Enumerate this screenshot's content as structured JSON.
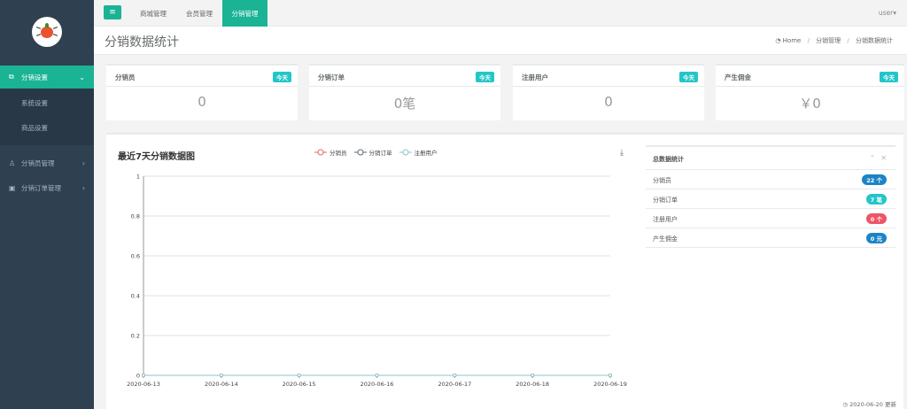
{
  "sidebar": {
    "items": [
      {
        "label": "分销设置",
        "icon": "sitemap-icon",
        "arrow": "⌄",
        "active": true
      },
      {
        "label": "分销员管理",
        "icon": "user-icon",
        "arrow": "›"
      },
      {
        "label": "分销订单管理",
        "icon": "order-icon",
        "arrow": "›"
      }
    ],
    "sub_items": [
      "系统设置",
      "商品设置"
    ]
  },
  "topbar": {
    "menu_icon": "bars-icon",
    "tabs": [
      "商城管理",
      "会员管理",
      "分销管理"
    ],
    "active_tab": "分销管理",
    "user": "user▾"
  },
  "heading": {
    "title": "分销数据统计",
    "breadcrumb": [
      "Home",
      "分销管理",
      "分销数据统计"
    ],
    "breadcrumb_icon": "dashboard-icon"
  },
  "cards": [
    {
      "title": "分销员",
      "badge": "今天",
      "value": "0"
    },
    {
      "title": "分销订单",
      "badge": "今天",
      "value": "0笔"
    },
    {
      "title": "注册用户",
      "badge": "今天",
      "value": "0"
    },
    {
      "title": "产生佣金",
      "badge": "今天",
      "value": "￥0"
    }
  ],
  "chart_data": {
    "type": "line",
    "title": "最近7天分销数据图",
    "x": [
      "2020-06-13",
      "2020-06-14",
      "2020-06-15",
      "2020-06-16",
      "2020-06-17",
      "2020-06-18",
      "2020-06-19"
    ],
    "series": [
      {
        "name": "分销员",
        "color": "#d96b5f",
        "values": [
          0,
          0,
          0,
          0,
          0,
          0,
          0
        ]
      },
      {
        "name": "分销订单",
        "color": "#5b6770",
        "values": [
          0,
          0,
          0,
          0,
          0,
          0,
          0
        ]
      },
      {
        "name": "注册用户",
        "color": "#8fc3c4",
        "values": [
          0,
          0,
          0,
          0,
          0,
          0,
          0
        ]
      }
    ],
    "y_ticks": [
      "0",
      "0.2",
      "0.4",
      "0.6",
      "0.8",
      "1"
    ],
    "ylim": [
      0,
      1
    ],
    "grid": true,
    "legend": "top-center"
  },
  "summary": {
    "title": "总数据统计",
    "rows": [
      {
        "label": "分销员",
        "value": "22 个",
        "color": "#1c84c6"
      },
      {
        "label": "分销订单",
        "value": "7 笔",
        "color": "#23c6c8"
      },
      {
        "label": "注册用户",
        "value": "0 个",
        "color": "#ed5565"
      },
      {
        "label": "产生佣金",
        "value": "0 元",
        "color": "#1c84c6"
      }
    ]
  },
  "footer": {
    "updated": "2020-06-20 更新"
  }
}
